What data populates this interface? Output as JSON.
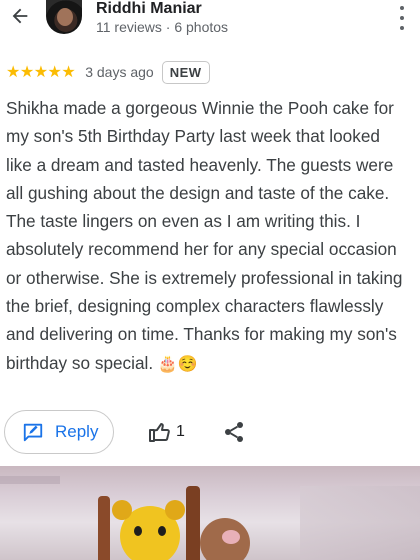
{
  "header": {
    "reviewer_name": "Riddhi Maniar",
    "reviewer_meta": "11 reviews · 6 photos"
  },
  "review": {
    "rating": 5,
    "stars": "★★★★★",
    "when": "3 days ago",
    "badge": "NEW",
    "text": "Shikha made a gorgeous Winnie the Pooh cake for my son's 5th Birthday Party last week that looked like a dream and tasted heavenly. The guests were all gushing about the design and taste of the cake. The taste lingers on even as I am writing this. I absolutely recommend her for any special occasion or otherwise. She is extremely professional in taking the brief, designing complex characters flawlessly and delivering on time. Thanks for making my son's birthday so special.",
    "emoji": "🎂☺️"
  },
  "actions": {
    "reply_label": "Reply",
    "like_count": "1"
  },
  "colors": {
    "accent": "#1a73e8",
    "star": "#fbbc04",
    "secondary_text": "#5f6368"
  },
  "icons": {
    "back": "arrow-left-icon",
    "more": "kebab-menu-icon",
    "reply": "reply-pencil-icon",
    "like": "thumbs-up-icon",
    "share": "share-icon"
  }
}
